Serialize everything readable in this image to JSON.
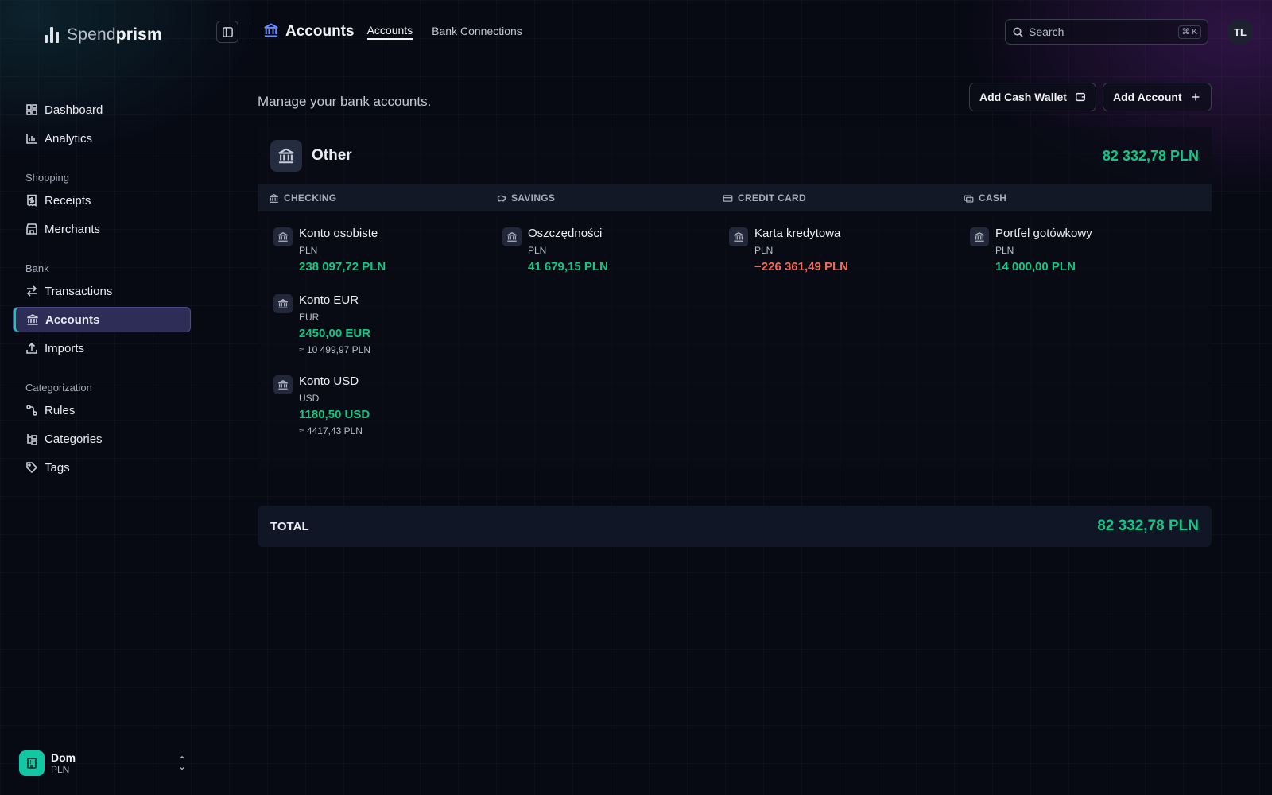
{
  "app": {
    "brand_light": "Spend",
    "brand_bold": "prism"
  },
  "sidebar": {
    "primary": [
      {
        "label": "Dashboard",
        "icon": "dashboard-icon"
      },
      {
        "label": "Analytics",
        "icon": "bar-chart-icon"
      }
    ],
    "shopping": {
      "title": "Shopping",
      "items": [
        {
          "label": "Receipts",
          "icon": "receipt-icon"
        },
        {
          "label": "Merchants",
          "icon": "store-icon"
        }
      ]
    },
    "bank": {
      "title": "Bank",
      "items": [
        {
          "label": "Transactions",
          "icon": "arrows-icon"
        },
        {
          "label": "Accounts",
          "icon": "bank-icon",
          "active": true
        },
        {
          "label": "Imports",
          "icon": "upload-icon"
        }
      ]
    },
    "categorization": {
      "title": "Categorization",
      "items": [
        {
          "label": "Rules",
          "icon": "rules-icon"
        },
        {
          "label": "Categories",
          "icon": "category-tree-icon"
        },
        {
          "label": "Tags",
          "icon": "tag-icon"
        }
      ]
    },
    "workspace": {
      "name": "Dom",
      "currency": "PLN"
    }
  },
  "header": {
    "title": "Accounts",
    "tabs": [
      {
        "label": "Accounts",
        "active": true
      },
      {
        "label": "Bank Connections",
        "active": false
      }
    ],
    "search": {
      "placeholder": "Search",
      "shortcut": "⌘ K"
    },
    "user_initials": "TL"
  },
  "main": {
    "subtitle": "Manage your bank accounts.",
    "buttons": {
      "add_cash_wallet": "Add Cash Wallet",
      "add_account": "Add Account"
    },
    "group": {
      "name": "Other",
      "total": "82 332,78 PLN",
      "columns": [
        {
          "label": "CHECKING",
          "icon": "bank-icon"
        },
        {
          "label": "SAVINGS",
          "icon": "piggy-bank-icon"
        },
        {
          "label": "CREDIT CARD",
          "icon": "credit-card-icon"
        },
        {
          "label": "CASH",
          "icon": "cash-icon"
        }
      ],
      "accounts": {
        "checking": [
          {
            "name": "Konto osobiste",
            "currency": "PLN",
            "balance": "238 097,72 PLN"
          },
          {
            "name": "Konto EUR",
            "currency": "EUR",
            "balance": "2450,00 EUR",
            "converted": "≈ 10 499,97 PLN"
          },
          {
            "name": "Konto USD",
            "currency": "USD",
            "balance": "1180,50 USD",
            "converted": "≈ 4417,43 PLN"
          }
        ],
        "savings": [
          {
            "name": "Oszczędności",
            "currency": "PLN",
            "balance": "41 679,15 PLN"
          }
        ],
        "credit_card": [
          {
            "name": "Karta kredytowa",
            "currency": "PLN",
            "balance": "−226 361,49 PLN"
          }
        ],
        "cash": [
          {
            "name": "Portfel gotówkowy",
            "currency": "PLN",
            "balance": "14 000,00 PLN"
          }
        ]
      }
    },
    "total": {
      "label": "TOTAL",
      "value": "82 332,78 PLN"
    }
  },
  "colors": {
    "accent": "#12c784",
    "negative": "#f06a5a",
    "active_nav": "#2d2d58",
    "indicator": "#22c7a9"
  }
}
